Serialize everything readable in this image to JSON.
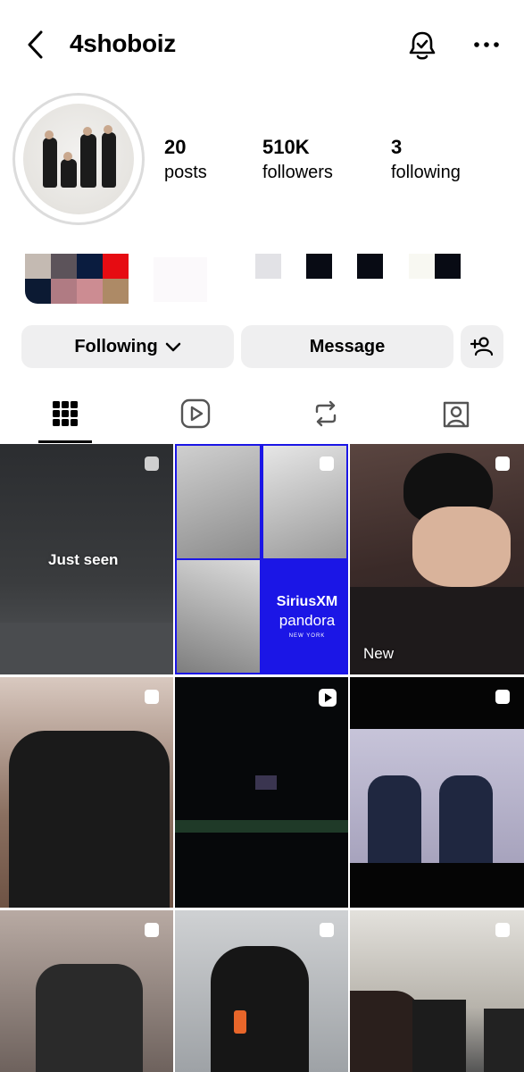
{
  "header": {
    "username": "4shoboiz"
  },
  "stats": [
    {
      "value": "20",
      "label": "posts"
    },
    {
      "value": "510K",
      "label": "followers"
    },
    {
      "value": "3",
      "label": "following"
    }
  ],
  "actions": {
    "following_label": "Following",
    "message_label": "Message"
  },
  "tabs": [
    "grid-icon",
    "reels-icon",
    "reposts-icon",
    "tagged-icon"
  ],
  "grid": {
    "labels": {
      "just_seen": "Just seen",
      "new": "New"
    },
    "ad": {
      "brand1": "SiriusXM",
      "brand2": "pandora",
      "city": "NEW YORK"
    }
  },
  "colors": {
    "accent_blue": "#1b16e6",
    "button_bg": "#efeff0"
  }
}
